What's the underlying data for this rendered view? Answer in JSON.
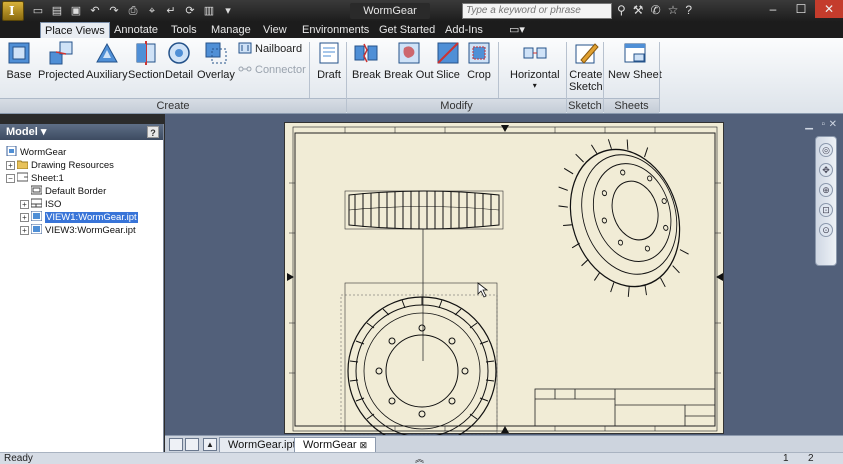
{
  "window": {
    "title": "WormGear"
  },
  "app": {
    "logo_letter": "I"
  },
  "search": {
    "placeholder": "Type a keyword or phrase"
  },
  "ribbon": {
    "tabs": [
      "Place Views",
      "Annotate",
      "Tools",
      "Manage",
      "View",
      "Environments",
      "Get Started",
      "Add-Ins"
    ],
    "active_tab": "Place Views",
    "buttons": {
      "base": "Base",
      "projected": "Projected",
      "auxiliary": "Auxiliary",
      "section": "Section",
      "detail": "Detail",
      "overlay": "Overlay",
      "nailboard": "Nailboard",
      "connector": "Connector",
      "draft": "Draft",
      "break": "Break",
      "break_out": "Break Out",
      "slice": "Slice",
      "crop": "Crop",
      "horizontal": "Horizontal",
      "create_sketch_line1": "Create",
      "create_sketch_line2": "Sketch",
      "new_sheet": "New Sheet"
    },
    "panels": {
      "create": "Create",
      "modify": "Modify",
      "sketch": "Sketch",
      "sheets": "Sheets"
    }
  },
  "browser": {
    "title": "Model",
    "help": "?",
    "items": [
      {
        "label": "WormGear"
      },
      {
        "label": "Drawing Resources"
      },
      {
        "label": "Sheet:1"
      },
      {
        "label": "Default Border"
      },
      {
        "label": "ISO"
      },
      {
        "label": "VIEW1:WormGear.ipt"
      },
      {
        "label": "VIEW3:WormGear.ipt"
      }
    ]
  },
  "doc_tabs": [
    "WormGear.ipt",
    "WormGear"
  ],
  "status": {
    "text": "Ready",
    "page_a": "1",
    "page_b": "2"
  },
  "colors": {
    "accent": "#3874d8",
    "sheet": "#f1ecd6",
    "canvas": "#52607a"
  }
}
